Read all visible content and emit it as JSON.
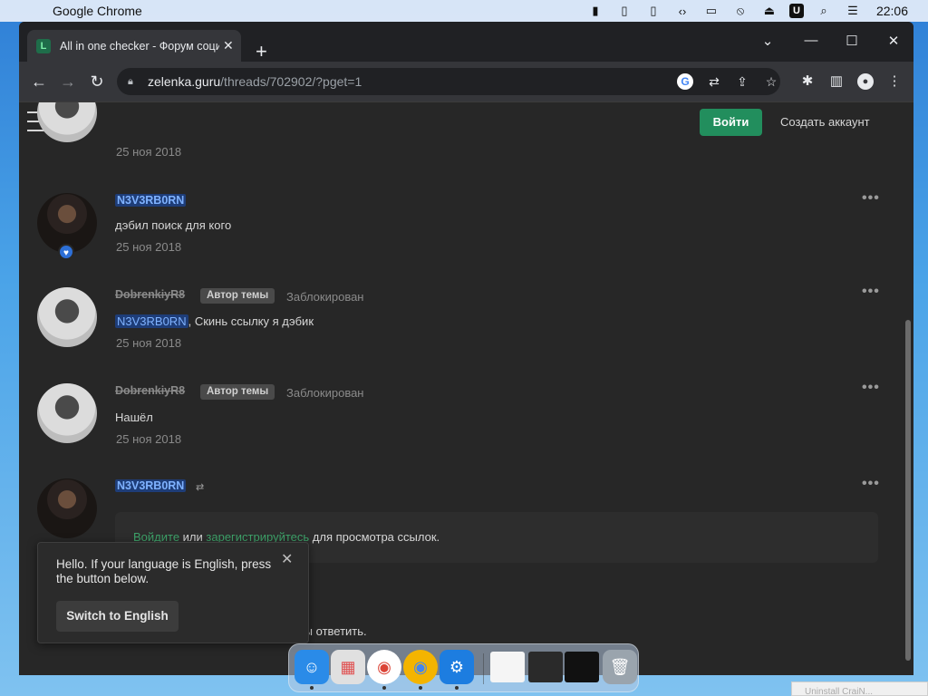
{
  "menubar": {
    "apple_icon": "apple-icon",
    "app_name": "Google Chrome",
    "status_icons": [
      "battery-icon",
      "phone-icon",
      "phone-outline-icon",
      "code-arrows-icon",
      "display-icon",
      "mute-icon",
      "eject-icon",
      "u-icon",
      "search-icon",
      "control-center-icon"
    ],
    "u_label": "U",
    "clock": "22:06"
  },
  "browser": {
    "tab": {
      "title": "All in one checker - Форум соци",
      "favicon": "L"
    },
    "address": {
      "domain": "zelenka.guru",
      "path": "/threads/702902/?pget=1"
    }
  },
  "header": {
    "login_label": "Войти",
    "register_label": "Создать аккаунт"
  },
  "posts": [
    {
      "date": "25 ноя 2018"
    },
    {
      "username": "N3V3RB0RN",
      "message": "дэбил поиск для кого",
      "date": "25 ноя 2018"
    },
    {
      "username": "DobrenkiyR8",
      "badge": "Автор темы",
      "status": "Заблокирован",
      "mention": "N3V3RB0RN",
      "message": ", Скинь ссылку я дэбик",
      "date": "25 ноя 2018"
    },
    {
      "username": "DobrenkiyR8",
      "badge": "Автор темы",
      "status": "Заблокирован",
      "message": "Нашёл",
      "date": "25 ноя 2018"
    },
    {
      "username": "N3V3RB0RN"
    }
  ],
  "hidden_content": {
    "login_link": "Войдите",
    "or_text": " или ",
    "register_link": "зарегистрируйтесь",
    "suffix": " для просмотра ссылок."
  },
  "reply_prompt": "обы ответить.",
  "language_popup": {
    "text": "Hello. If your language is English, press the button below.",
    "button": "Switch to English"
  },
  "corner_window_text": "Uninstall CraiN..."
}
